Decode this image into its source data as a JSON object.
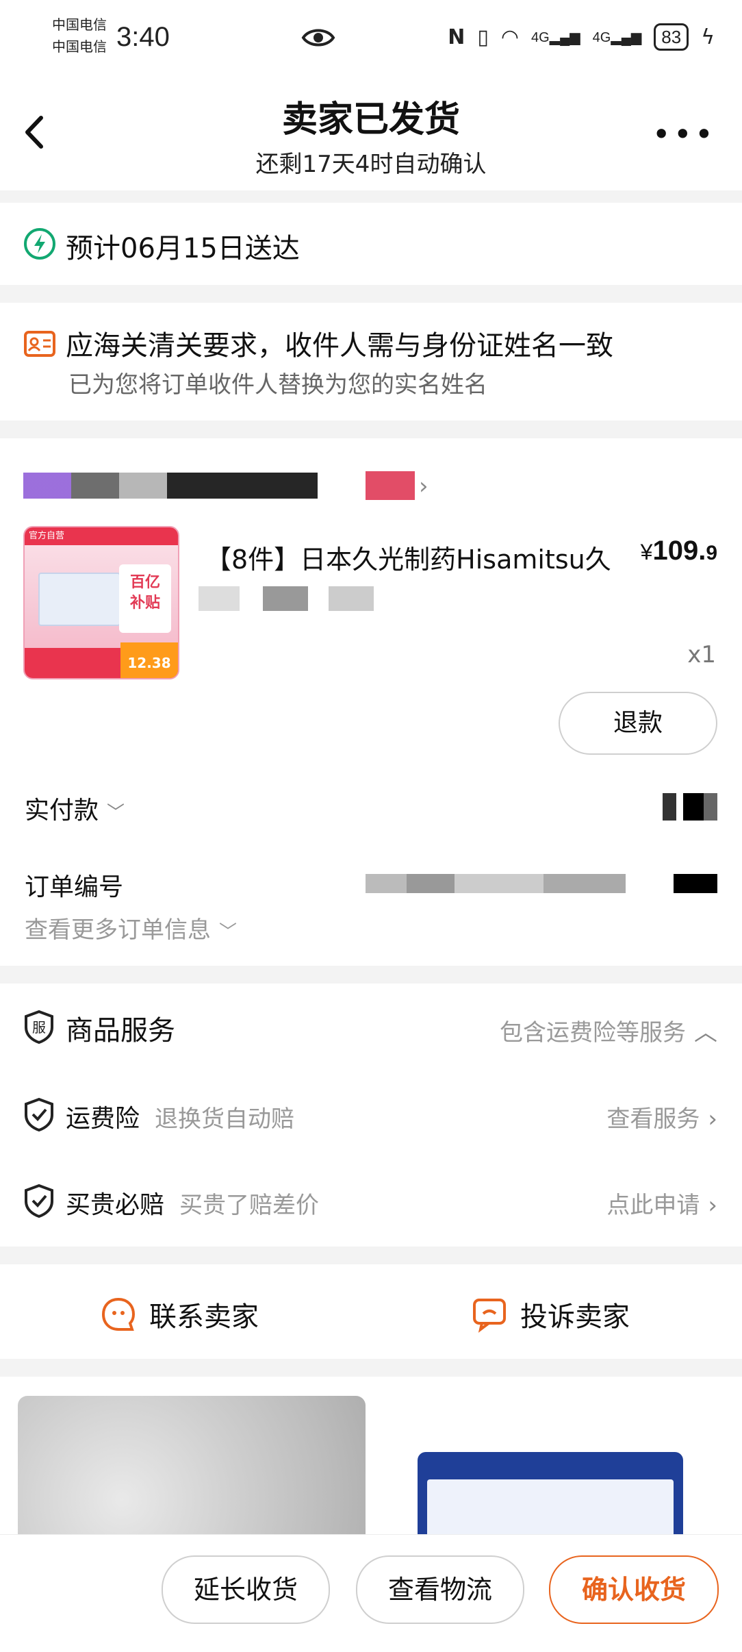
{
  "status_bar": {
    "carrier1": "中国电信",
    "carrier2": "中国电信",
    "time": "3:40",
    "network1": "4G",
    "network2": "4G",
    "battery": "83"
  },
  "header": {
    "title": "卖家已发货",
    "subtitle": "还剩17天4时自动确认"
  },
  "delivery": {
    "eta": "预计06月15日送达"
  },
  "customs_notice": {
    "title": "应海关清关要求，收件人需与身份证姓名一致",
    "subtitle": "已为您将订单收件人替换为您的实名姓名"
  },
  "product": {
    "image_top": "官方自营",
    "image_badge_line1": "百亿",
    "image_badge_line2": "补贴",
    "image_price": "12.38",
    "name": "【8件】日本久光制药Hisamitsu久",
    "price_currency": "¥",
    "price_int": "109.",
    "price_dec": "9",
    "quantity": "x1",
    "refund_label": "退款"
  },
  "order": {
    "paid_label": "实付款",
    "order_no_label": "订单编号",
    "more_info": "查看更多订单信息"
  },
  "services": {
    "title": "商品服务",
    "summary": "包含运费险等服务",
    "items": [
      {
        "name": "运费险",
        "desc": "退换货自动赔",
        "action": "查看服务"
      },
      {
        "name": "买贵必赔",
        "desc": "买贵了赔差价",
        "action": "点此申请"
      }
    ]
  },
  "contact": {
    "seller": "联系卖家",
    "complain": "投诉卖家"
  },
  "bottom_actions": {
    "extend": "延长收货",
    "logistics": "查看物流",
    "confirm": "确认收货"
  },
  "colors": {
    "accent": "#e8641e",
    "green": "#12a871",
    "muted": "#999999"
  }
}
